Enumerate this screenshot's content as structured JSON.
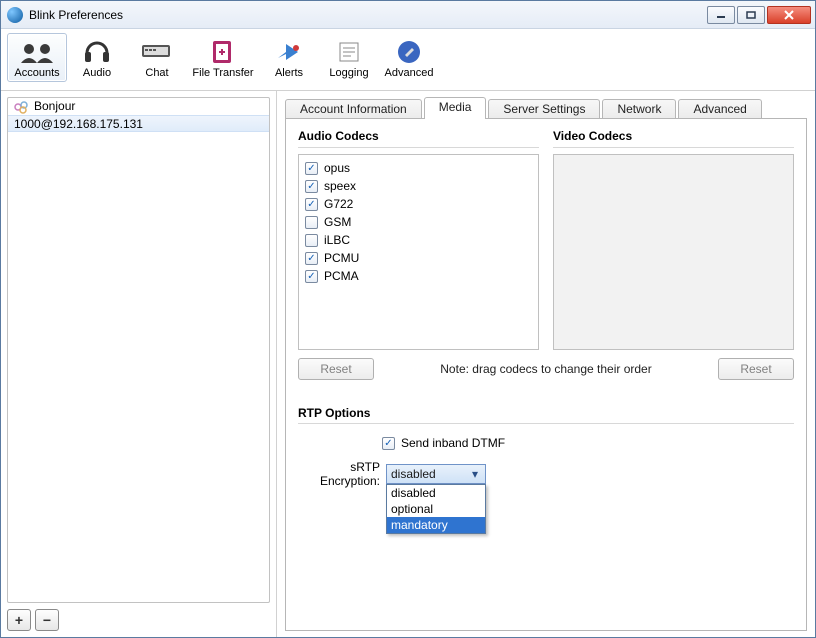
{
  "window": {
    "title": "Blink Preferences"
  },
  "toolbar": [
    {
      "label": "Accounts",
      "active": true
    },
    {
      "label": "Audio"
    },
    {
      "label": "Chat"
    },
    {
      "label": "File Transfer"
    },
    {
      "label": "Alerts"
    },
    {
      "label": "Logging"
    },
    {
      "label": "Advanced"
    }
  ],
  "sidebar": {
    "rows": [
      {
        "label": "Bonjour",
        "bonjour": true
      },
      {
        "label": "1000@192.168.175.131",
        "selected": true
      }
    ],
    "add_label": "+",
    "remove_label": "−"
  },
  "tabs": [
    {
      "label": "Account Information"
    },
    {
      "label": "Media",
      "active": true
    },
    {
      "label": "Server Settings"
    },
    {
      "label": "Network"
    },
    {
      "label": "Advanced"
    }
  ],
  "media": {
    "audio_title": "Audio Codecs",
    "video_title": "Video Codecs",
    "audio_codecs": [
      {
        "name": "opus",
        "checked": true
      },
      {
        "name": "speex",
        "checked": true
      },
      {
        "name": "G722",
        "checked": true
      },
      {
        "name": "GSM",
        "checked": false
      },
      {
        "name": "iLBC",
        "checked": false
      },
      {
        "name": "PCMU",
        "checked": true
      },
      {
        "name": "PCMA",
        "checked": true
      }
    ],
    "reset_label": "Reset",
    "note": "Note: drag codecs to change their order"
  },
  "rtp": {
    "title": "RTP Options",
    "inband_label": "Send inband DTMF",
    "inband_checked": true,
    "srtp_label": "sRTP Encryption:",
    "srtp_value": "disabled",
    "srtp_options": [
      {
        "label": "disabled"
      },
      {
        "label": "optional"
      },
      {
        "label": "mandatory",
        "highlighted": true
      }
    ]
  }
}
